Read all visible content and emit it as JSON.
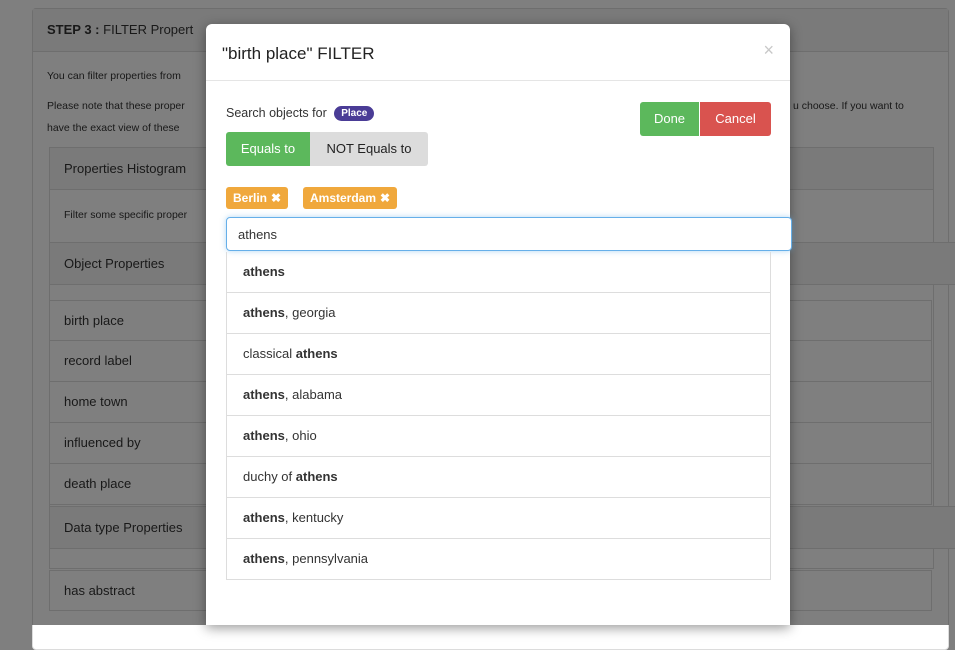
{
  "background": {
    "step_title": "STEP 3 :",
    "step_title_rest": "FILTER Propert",
    "intro1": "You can filter properties from",
    "intro2a": "Please note that these proper",
    "intro2b": "u choose. If you want to",
    "intro3": "have the exact view of these",
    "histogram_heading": "Properties Histogram",
    "filter_hint": "Filter some specific proper",
    "object_properties_heading": "Object Properties",
    "object_properties": [
      "birth place",
      "record label",
      "home town",
      "influenced by",
      "death place"
    ],
    "datatype_heading": "Data type Properties",
    "datatype_properties": [
      "has abstract"
    ]
  },
  "modal": {
    "title": "\"birth place\" FILTER",
    "close": "×",
    "search_label": "Search objects for",
    "type_badge": "Place",
    "done": "Done",
    "cancel": "Cancel",
    "equals": "Equals to",
    "not_equals": "NOT Equals to",
    "tags": [
      {
        "label": "Berlin",
        "remove": "✖"
      },
      {
        "label": "Amsterdam",
        "remove": "✖"
      }
    ],
    "search_value": "athens",
    "suggestions": [
      {
        "pre": "",
        "match": "athens",
        "post": ""
      },
      {
        "pre": "",
        "match": "athens",
        "post": ", georgia"
      },
      {
        "pre": "classical ",
        "match": "athens",
        "post": ""
      },
      {
        "pre": "",
        "match": "athens",
        "post": ", alabama"
      },
      {
        "pre": "",
        "match": "athens",
        "post": ", ohio"
      },
      {
        "pre": "duchy of ",
        "match": "athens",
        "post": ""
      },
      {
        "pre": "",
        "match": "athens",
        "post": ", kentucky"
      },
      {
        "pre": "",
        "match": "athens",
        "post": ", pennsylvania"
      }
    ]
  },
  "colors": {
    "success": "#5cb85c",
    "danger": "#d9534f",
    "tag": "#f0a83c",
    "badge": "#4a3c96"
  }
}
